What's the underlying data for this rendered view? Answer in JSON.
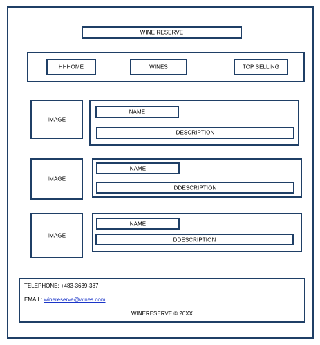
{
  "header": {
    "title": "WINE RESERVE"
  },
  "nav": {
    "items": [
      "HHHOME",
      "WINES",
      "TOP SELLING"
    ]
  },
  "products": [
    {
      "image": "IMAGE",
      "name": "NAME",
      "description": "DESCRIPTION"
    },
    {
      "image": "IMAGE",
      "name": "NAME",
      "description": "DDESCRIPTION"
    },
    {
      "image": "IMAGE",
      "name": "NAME",
      "description": "DDESCRIPTION"
    }
  ],
  "footer": {
    "telephone": "TELEPHONE: +483-3639-387",
    "email_label": "EMAIL:",
    "email": "winereserve@wines.com",
    "copyright": "WINERESERVE © 20XX"
  },
  "colors": {
    "border": "#1f3f66",
    "link": "#1a35c8"
  }
}
